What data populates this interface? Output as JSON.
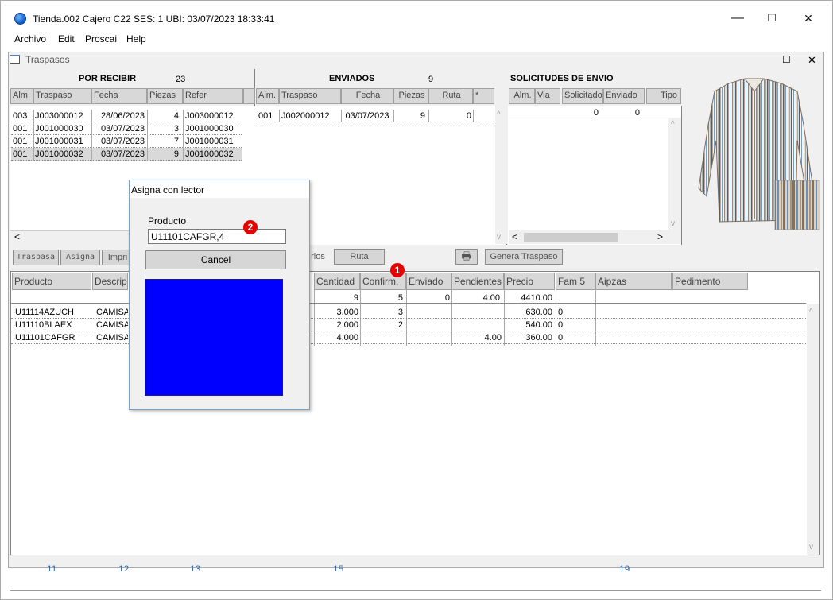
{
  "window": {
    "title": "Tienda.002  Cajero C22     SES: 1   UBI:    03/07/2023 18:33:41",
    "min": "—",
    "max": "☐",
    "close": "✕"
  },
  "menu": [
    "Archivo",
    "Edit",
    "Proscai",
    "Help"
  ],
  "child_window": {
    "title": "Traspasos",
    "max": "☐",
    "close": "✕"
  },
  "por_recibir": {
    "header": "POR RECIBIR",
    "count": "23",
    "columns": [
      "Alm",
      "Traspaso",
      "Fecha",
      "Piezas",
      "Refer"
    ],
    "rows": [
      [
        "003",
        "J003000012",
        "28/06/2023",
        "4",
        "J003000012"
      ],
      [
        "001",
        "J001000030",
        "03/07/2023",
        "3",
        "J001000030"
      ],
      [
        "001",
        "J001000031",
        "03/07/2023",
        "7",
        "J001000031"
      ],
      [
        "001",
        "J001000032",
        "03/07/2023",
        "9",
        "J001000032"
      ]
    ]
  },
  "enviados": {
    "header": "ENVIADOS",
    "count": "9",
    "columns": [
      "Alm.",
      "Traspaso",
      "Fecha",
      "Piezas",
      "Ruta",
      "*"
    ],
    "rows": [
      [
        "001",
        "J002000012",
        "03/07/2023",
        "9",
        "0"
      ]
    ]
  },
  "solicitudes": {
    "header": "SOLICITUDES DE ENVIO",
    "columns": [
      "Alm.",
      "Via",
      "Solicitado",
      "Enviado",
      "Tipo"
    ],
    "totals": [
      "0",
      "0"
    ]
  },
  "toolbar": {
    "traspasa": "Traspasa",
    "asigna": "Asigna",
    "imprime": "Impri",
    "varios": "rios",
    "ruta": "Ruta",
    "genera": "Genera Traspaso"
  },
  "detail": {
    "columns": [
      "Producto",
      "Descripc",
      "Cantidad",
      "Confirm.",
      "Enviado",
      "Pendientes",
      "Precio",
      "Fam 5",
      "Aipzas",
      "Pedimento"
    ],
    "totals": {
      "cantidad": "9",
      "confirm": "5",
      "enviado": "0",
      "pendientes": "4.00",
      "precio": "4410.00"
    },
    "rows": [
      {
        "producto": "U11114AZUCH",
        "descripcion": "CAMISA",
        "cantidad": "3.000",
        "confirm": "3",
        "enviado": "",
        "pendientes": "",
        "precio": "630.00",
        "fam": "0"
      },
      {
        "producto": "U11110BLAEX",
        "descripcion": "CAMISA",
        "cantidad": "2.000",
        "confirm": "2",
        "enviado": "",
        "pendientes": "",
        "precio": "540.00",
        "fam": "0"
      },
      {
        "producto": "U11101CAFGR",
        "descripcion": "CAMISA",
        "cantidad": "4.000",
        "confirm": "",
        "enviado": "",
        "pendientes": "4.00",
        "precio": "360.00",
        "fam": "0"
      }
    ]
  },
  "dialog": {
    "title": "Asigna con lector",
    "label": "Producto",
    "value": "U11101CAFGR,4",
    "cancel": "Cancel",
    "swatch_color": "#0000ff"
  },
  "badges": {
    "one": "1",
    "two": "2"
  },
  "footer_numbers": [
    "11",
    "12",
    "13",
    "15",
    "19"
  ],
  "colors": {
    "badge": "#e60000",
    "swatch": "#0000ff"
  }
}
